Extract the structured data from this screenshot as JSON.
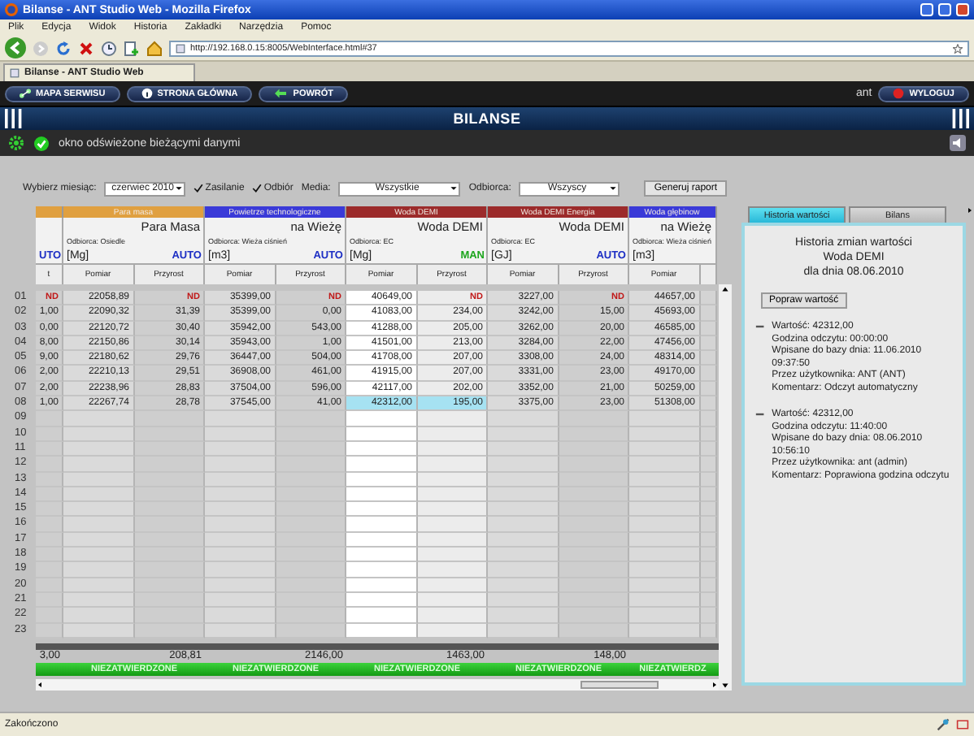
{
  "window": {
    "title": "Bilanse - ANT Studio Web - Mozilla Firefox"
  },
  "menu": [
    "Plik",
    "Edycja",
    "Widok",
    "Historia",
    "Zakładki",
    "Narzędzia",
    "Pomoc"
  ],
  "address_bar": {
    "value": "http://192.168.0.15:8005/WebInterface.html#37"
  },
  "browser_tabs": [
    {
      "label": "Bilanse - ANT Studio Web",
      "selected": true
    }
  ],
  "app_nav": {
    "buttons": [
      {
        "label": "MAPA SERWISU",
        "kind": "map"
      },
      {
        "label": "STRONA GŁÓWNA",
        "kind": "home"
      },
      {
        "label": "POWRÓT",
        "kind": "back"
      }
    ],
    "user": "ant",
    "logout": "WYLOGUJ"
  },
  "page_title": "BILANSE",
  "status": {
    "message": "okno odświeżone bieżącymi danymi"
  },
  "filters": {
    "month_label": "Wybierz miesiąc:",
    "month": "czerwiec 2010",
    "checkboxes": [
      {
        "label": "Zasilanie",
        "checked": true
      },
      {
        "label": "Odbiór",
        "checked": true
      }
    ],
    "media_label": "Media:",
    "media": "Wszystkie",
    "recipient_label": "Odbiorca:",
    "recipient": "Wszyscy",
    "generate_button": "Generuj raport"
  },
  "table": {
    "groups": [
      {
        "color": "#e0a040",
        "mode": {
          "text": "UTO",
          "kind": "auto"
        },
        "selected": false,
        "columns": [
          "t"
        ],
        "total": "3,00"
      },
      {
        "category": "Para masa",
        "color": "#e0a040",
        "name": "Para Masa",
        "recipient": "Odbiorca: Osiedle",
        "unit": "[Mg]",
        "mode": {
          "text": "AUTO",
          "kind": "auto"
        },
        "selected": false,
        "columns": [
          "Pomiar",
          "Przyrost"
        ],
        "total": "208,81",
        "approval": "NIEZATWIERDZONE"
      },
      {
        "category": "Powietrze technologiczne",
        "color": "#3a3ad8",
        "name": "na Wieżę",
        "recipient": "Odbiorca: Wieża ciśnień",
        "unit": "[m3]",
        "mode": {
          "text": "AUTO",
          "kind": "auto"
        },
        "selected": false,
        "columns": [
          "Pomiar",
          "Przyrost"
        ],
        "total": "2146,00",
        "approval": "NIEZATWIERDZONE"
      },
      {
        "category": "Woda DEMI",
        "color": "#9c2b2b",
        "name": "Woda DEMI",
        "recipient": "Odbiorca: EC",
        "unit": "[Mg]",
        "mode": {
          "text": "MAN",
          "kind": "man"
        },
        "selected": true,
        "columns": [
          "Pomiar",
          "Przyrost"
        ],
        "total": "1463,00",
        "approval": "NIEZATWIERDZONE"
      },
      {
        "category": "Woda DEMI Energia",
        "color": "#9c2b2b",
        "name": "Woda DEMI",
        "recipient": "Odbiorca: EC",
        "unit": "[GJ]",
        "mode": {
          "text": "AUTO",
          "kind": "auto"
        },
        "selected": false,
        "columns": [
          "Pomiar",
          "Przyrost"
        ],
        "total": "148,00",
        "approval": "NIEZATWIERDZONE"
      },
      {
        "category": "Woda głębinow",
        "color": "#3a3ad8",
        "name": "na Wieżę",
        "recipient": "Odbiorca: Wieża ciśnień",
        "unit": "[m3]",
        "selected": false,
        "columns": [
          "Pomiar"
        ],
        "approval": "NIEZATWIERDZ"
      }
    ],
    "rows": [
      {
        "num": "01",
        "selected": false,
        "cells": [
          {
            "text": "ND",
            "kind": "nd"
          },
          {
            "text": "22058,89",
            "kind": "value"
          },
          {
            "text": "ND",
            "kind": "nd"
          },
          {
            "text": "35399,00",
            "kind": "value"
          },
          {
            "text": "ND",
            "kind": "nd"
          },
          {
            "text": "40649,00",
            "kind": "value"
          },
          {
            "text": "ND",
            "kind": "nd"
          },
          {
            "text": "3227,00",
            "kind": "value"
          },
          {
            "text": "ND",
            "kind": "nd"
          },
          {
            "text": "44657,00",
            "kind": "value"
          }
        ]
      },
      {
        "num": "02",
        "selected": false,
        "cells": [
          {
            "text": "1,00",
            "kind": "value"
          },
          {
            "text": "22090,32",
            "kind": "value"
          },
          {
            "text": "31,39",
            "kind": "value"
          },
          {
            "text": "35399,00",
            "kind": "value"
          },
          {
            "text": "0,00",
            "kind": "value"
          },
          {
            "text": "41083,00",
            "kind": "value"
          },
          {
            "text": "234,00",
            "kind": "value"
          },
          {
            "text": "3242,00",
            "kind": "value"
          },
          {
            "text": "15,00",
            "kind": "value"
          },
          {
            "text": "45693,00",
            "kind": "value"
          }
        ]
      },
      {
        "num": "03",
        "selected": false,
        "cells": [
          {
            "text": "0,00",
            "kind": "value"
          },
          {
            "text": "22120,72",
            "kind": "value"
          },
          {
            "text": "30,40",
            "kind": "value"
          },
          {
            "text": "35942,00",
            "kind": "value"
          },
          {
            "text": "543,00",
            "kind": "value"
          },
          {
            "text": "41288,00",
            "kind": "value"
          },
          {
            "text": "205,00",
            "kind": "value"
          },
          {
            "text": "3262,00",
            "kind": "value"
          },
          {
            "text": "20,00",
            "kind": "value"
          },
          {
            "text": "46585,00",
            "kind": "value"
          }
        ]
      },
      {
        "num": "04",
        "selected": false,
        "cells": [
          {
            "text": "8,00",
            "kind": "value"
          },
          {
            "text": "22150,86",
            "kind": "value"
          },
          {
            "text": "30,14",
            "kind": "value"
          },
          {
            "text": "35943,00",
            "kind": "value"
          },
          {
            "text": "1,00",
            "kind": "value"
          },
          {
            "text": "41501,00",
            "kind": "value"
          },
          {
            "text": "213,00",
            "kind": "value"
          },
          {
            "text": "3284,00",
            "kind": "value"
          },
          {
            "text": "22,00",
            "kind": "value"
          },
          {
            "text": "47456,00",
            "kind": "value"
          }
        ]
      },
      {
        "num": "05",
        "selected": false,
        "cells": [
          {
            "text": "9,00",
            "kind": "value"
          },
          {
            "text": "22180,62",
            "kind": "value"
          },
          {
            "text": "29,76",
            "kind": "value"
          },
          {
            "text": "36447,00",
            "kind": "value"
          },
          {
            "text": "504,00",
            "kind": "value"
          },
          {
            "text": "41708,00",
            "kind": "value"
          },
          {
            "text": "207,00",
            "kind": "value"
          },
          {
            "text": "3308,00",
            "kind": "value"
          },
          {
            "text": "24,00",
            "kind": "value"
          },
          {
            "text": "48314,00",
            "kind": "value"
          }
        ]
      },
      {
        "num": "06",
        "selected": false,
        "cells": [
          {
            "text": "2,00",
            "kind": "value"
          },
          {
            "text": "22210,13",
            "kind": "value"
          },
          {
            "text": "29,51",
            "kind": "value"
          },
          {
            "text": "36908,00",
            "kind": "value"
          },
          {
            "text": "461,00",
            "kind": "value"
          },
          {
            "text": "41915,00",
            "kind": "value"
          },
          {
            "text": "207,00",
            "kind": "value"
          },
          {
            "text": "3331,00",
            "kind": "value"
          },
          {
            "text": "23,00",
            "kind": "value"
          },
          {
            "text": "49170,00",
            "kind": "value"
          }
        ]
      },
      {
        "num": "07",
        "selected": false,
        "cells": [
          {
            "text": "2,00",
            "kind": "value"
          },
          {
            "text": "22238,96",
            "kind": "value"
          },
          {
            "text": "28,83",
            "kind": "value"
          },
          {
            "text": "37504,00",
            "kind": "value"
          },
          {
            "text": "596,00",
            "kind": "value"
          },
          {
            "text": "42117,00",
            "kind": "value"
          },
          {
            "text": "202,00",
            "kind": "value"
          },
          {
            "text": "3352,00",
            "kind": "value"
          },
          {
            "text": "21,00",
            "kind": "value"
          },
          {
            "text": "50259,00",
            "kind": "value"
          }
        ]
      },
      {
        "num": "08",
        "selected": true,
        "cells": [
          {
            "text": "1,00",
            "kind": "value"
          },
          {
            "text": "22267,74",
            "kind": "value"
          },
          {
            "text": "28,78",
            "kind": "value"
          },
          {
            "text": "37545,00",
            "kind": "value"
          },
          {
            "text": "41,00",
            "kind": "value"
          },
          {
            "text": "42312,00",
            "kind": "value"
          },
          {
            "text": "195,00",
            "kind": "value"
          },
          {
            "text": "3375,00",
            "kind": "value"
          },
          {
            "text": "23,00",
            "kind": "value"
          },
          {
            "text": "51308,00",
            "kind": "value"
          }
        ]
      },
      {
        "num": "09",
        "selected": false
      },
      {
        "num": "10",
        "selected": false
      },
      {
        "num": "11",
        "selected": false
      },
      {
        "num": "12",
        "selected": false
      },
      {
        "num": "13",
        "selected": false
      },
      {
        "num": "14",
        "selected": false
      },
      {
        "num": "15",
        "selected": false
      },
      {
        "num": "16",
        "selected": false
      },
      {
        "num": "17",
        "selected": false
      },
      {
        "num": "18",
        "selected": false
      },
      {
        "num": "19",
        "selected": false
      },
      {
        "num": "20",
        "selected": false
      },
      {
        "num": "21",
        "selected": false
      },
      {
        "num": "22",
        "selected": false
      },
      {
        "num": "23",
        "selected": false
      }
    ]
  },
  "side_panel": {
    "tabs": [
      {
        "label": "Historia wartości",
        "selected": true
      },
      {
        "label": "Bilans",
        "selected": false
      }
    ],
    "title": "Historia zmian wartości",
    "subtitle": "Woda DEMI",
    "date": "dla dnia 08.06.2010",
    "button": "Popraw wartość",
    "entries": [
      {
        "expanded": true,
        "lines": [
          "Wartość: 42312,00",
          "Godzina odczytu: 00:00:00",
          "Wpisane do bazy dnia: 11.06.2010 09:37:50",
          "Przez użytkownika: ANT (ANT)",
          "Komentarz: Odczyt automatyczny"
        ]
      },
      {
        "expanded": true,
        "lines": [
          "Wartość: 42312,00",
          "Godzina odczytu: 11:40:00",
          "Wpisane do bazy dnia: 08.06.2010 10:56:10",
          "Przez użytkownika: ant (admin)",
          "Komentarz: Poprawiona godzina odczytu"
        ]
      }
    ]
  },
  "status_bar": {
    "text": "Zakończono"
  }
}
